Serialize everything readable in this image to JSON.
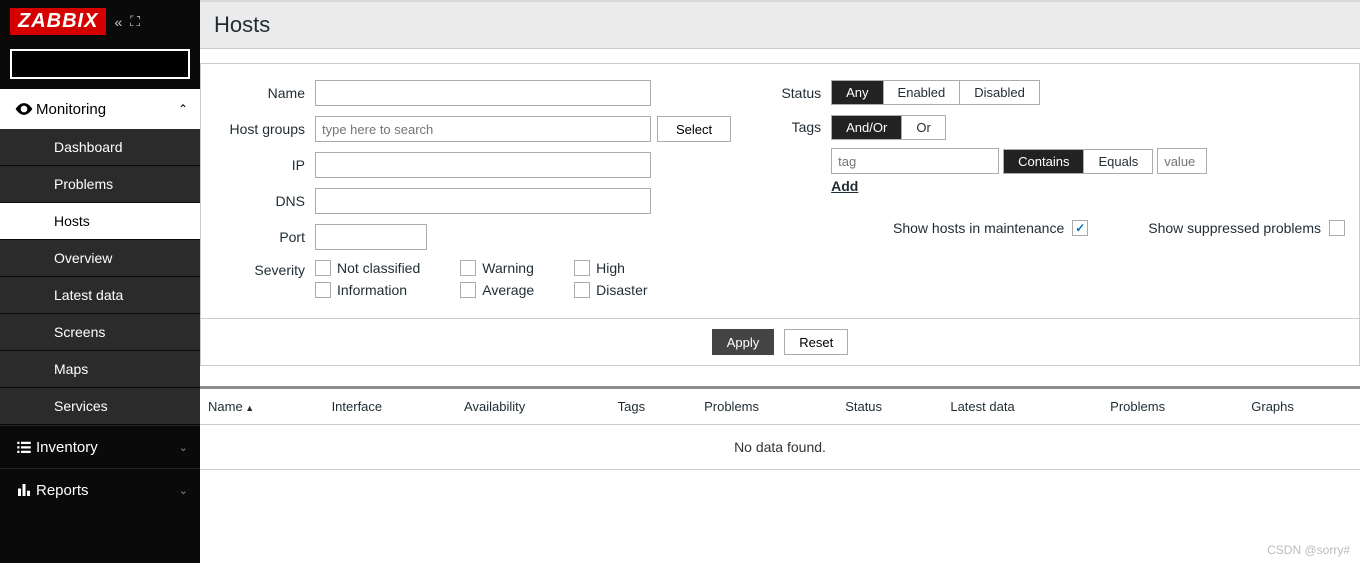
{
  "brand": "ZABBIX",
  "page_title": "Hosts",
  "sidebar": {
    "sections": [
      {
        "label": "Monitoring",
        "expanded": true,
        "icon": "eye",
        "items": [
          "Dashboard",
          "Problems",
          "Hosts",
          "Overview",
          "Latest data",
          "Screens",
          "Maps",
          "Services"
        ],
        "active_index": 2
      },
      {
        "label": "Inventory",
        "expanded": false,
        "icon": "list"
      },
      {
        "label": "Reports",
        "expanded": false,
        "icon": "bar"
      }
    ]
  },
  "filter": {
    "labels": {
      "name": "Name",
      "host_groups": "Host groups",
      "ip": "IP",
      "dns": "DNS",
      "port": "Port",
      "severity": "Severity",
      "status": "Status",
      "tags": "Tags",
      "maintenance": "Show hosts in maintenance",
      "suppressed": "Show suppressed problems"
    },
    "host_groups_placeholder": "type here to search",
    "select_btn": "Select",
    "status_options": [
      "Any",
      "Enabled",
      "Disabled"
    ],
    "status_active": 0,
    "tag_mode_options": [
      "And/Or",
      "Or"
    ],
    "tag_mode_active": 0,
    "tag_placeholder": "tag",
    "value_placeholder": "value",
    "tag_op_options": [
      "Contains",
      "Equals"
    ],
    "tag_op_active": 0,
    "add_label": "Add",
    "severities": [
      [
        "Not classified",
        "Information"
      ],
      [
        "Warning",
        "Average"
      ],
      [
        "High",
        "Disaster"
      ]
    ],
    "maintenance_checked": true,
    "suppressed_checked": false,
    "apply": "Apply",
    "reset": "Reset"
  },
  "table": {
    "columns": [
      "Name",
      "Interface",
      "Availability",
      "Tags",
      "Problems",
      "Status",
      "Latest data",
      "Problems",
      "Graphs"
    ],
    "sort_col": 0,
    "no_data": "No data found."
  },
  "watermark": "CSDN @sorry#"
}
